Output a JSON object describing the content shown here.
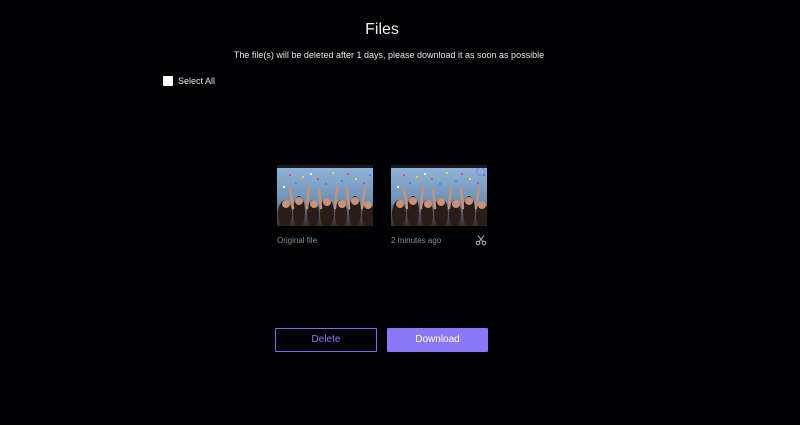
{
  "header": {
    "title": "Files",
    "notice": "The file(s) will be deleted after 1 days, please download it as soon as possible"
  },
  "select_all": {
    "label": "Select All",
    "checked": false
  },
  "files": [
    {
      "caption": "Original file",
      "thumbnail": "crowd-confetti-image",
      "has_cut_icon": false
    },
    {
      "caption": "2 minutes ago",
      "thumbnail": "crowd-confetti-image",
      "has_cut_icon": true
    }
  ],
  "actions": {
    "delete_label": "Delete",
    "download_label": "Download"
  },
  "colors": {
    "background": "#020104",
    "accent": "#8b78f6",
    "muted_text": "#8c8c8c"
  },
  "icons": {
    "cut": "scissors-icon",
    "select": "circle-select-icon"
  }
}
